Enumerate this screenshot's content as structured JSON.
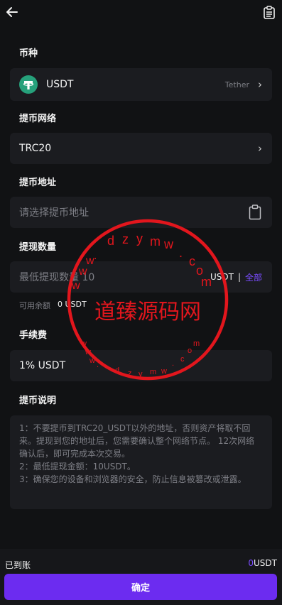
{
  "header": {
    "back_icon": "arrow-left-icon",
    "records_icon": "document-list-icon"
  },
  "coin": {
    "label": "币种",
    "symbol": "USDT",
    "name": "Tether",
    "icon": "tether-logo-icon",
    "icon_color": "#26a17b"
  },
  "network": {
    "label": "提币网络",
    "value": "TRC20"
  },
  "address": {
    "label": "提币地址",
    "placeholder": "请选择提币地址",
    "icon": "clipboard-icon"
  },
  "amount": {
    "label": "提现数量",
    "placeholder": "最低提现数量 10",
    "unit": "USDT",
    "separator": "|",
    "all_label": "全部",
    "available_label": "可用余额",
    "available_value": "0 USDT"
  },
  "fee": {
    "label": "手续费",
    "value": "1% USDT"
  },
  "notes": {
    "label": "提币说明",
    "text": "1：不要提币到TRC20_USDT以外的地址，否则资产将取不回来。提现到您的地址后，您需要确认整个网络节点。 12次网络确认后，即可完成本次交易。\n2：最低提现金额：10USDT。\n3：确保您的设备和浏览器的安全，防止信息被篡改或泄露。"
  },
  "footer": {
    "received_label": "已到账",
    "received_value": "0",
    "received_unit": "USDT",
    "confirm_label": "确定"
  },
  "watermark": {
    "center": "道臻源码网",
    "top_letters": [
      "d",
      "z",
      "y",
      "m",
      "w",
      ".",
      "c",
      "o",
      "m"
    ],
    "left_letters": [
      ".",
      "w",
      "w",
      "w"
    ],
    "bottom_letters": [
      "w",
      "w",
      "w",
      ".",
      "d",
      "z",
      "y",
      "m",
      "w",
      ".",
      "c",
      "o",
      "m"
    ],
    "color": "#e2161d"
  },
  "colors": {
    "accent": "#6c2cf0",
    "link": "#7a4cff",
    "background": "#111214",
    "surface": "#1b1c20"
  }
}
